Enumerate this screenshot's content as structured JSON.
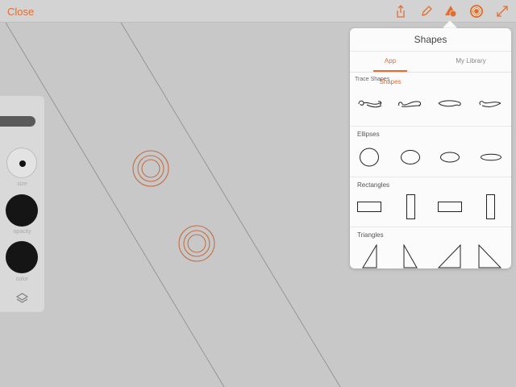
{
  "topbar": {
    "close_label": "Close",
    "icons": [
      "share-icon",
      "pencil-icon",
      "shapes-icon",
      "target-icon",
      "expand-icon"
    ]
  },
  "colors": {
    "accent": "#e36d2f",
    "canvas": "#c8c8c8"
  },
  "tool_panel": {
    "size_label": "size",
    "opacity_label": "opacity",
    "color_label": "color"
  },
  "shapes_popover": {
    "title": "Shapes",
    "tabs": [
      {
        "label": "App Shapes",
        "active": true
      },
      {
        "label": "My Library",
        "active": false
      }
    ],
    "sections": [
      {
        "title": "Trace Shapes",
        "items": [
          "scroll-ornament-1",
          "scroll-ornament-2",
          "scroll-ornament-3",
          "scroll-ornament-4"
        ]
      },
      {
        "title": "Ellipses",
        "items": [
          "ellipse-circle",
          "ellipse-wide",
          "ellipse-wider",
          "ellipse-flat"
        ]
      },
      {
        "title": "Rectangles",
        "items": [
          "rect-horizontal",
          "rect-vertical",
          "rect-horizontal-2",
          "rect-vertical-2"
        ]
      },
      {
        "title": "Triangles",
        "items": [
          "triangle-1",
          "triangle-2",
          "triangle-3",
          "triangle-4"
        ]
      }
    ]
  }
}
